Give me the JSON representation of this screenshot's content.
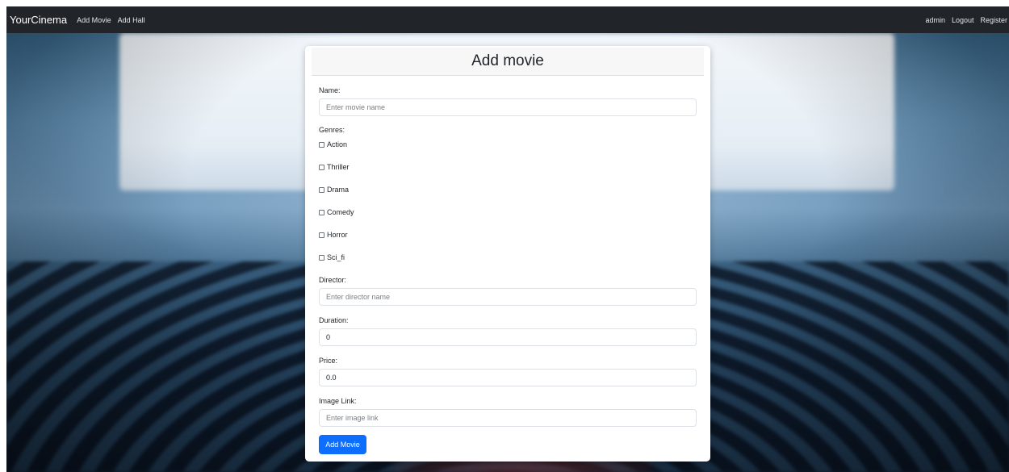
{
  "navbar": {
    "brand": "YourCinema",
    "links": [
      "Add Movie",
      "Add Hall"
    ],
    "right_links": [
      "admin",
      "Logout",
      "Register"
    ],
    "background_color": "#212529"
  },
  "form": {
    "title": "Add movie",
    "name_label": "Name:",
    "name_placeholder": "Enter movie name",
    "genres_label": "Genres:",
    "genres": [
      "Action",
      "Thriller",
      "Drama",
      "Comedy",
      "Horror",
      "Sci_fi"
    ],
    "director_label": "Director:",
    "director_placeholder": "Enter director name",
    "duration_label": "Duration:",
    "duration_value": "0",
    "price_label": "Price:",
    "price_value": "0.0",
    "image_label": "Image Link:",
    "image_placeholder": "Enter image link",
    "submit_label": "Add Movie",
    "accent_color": "#0d6efd"
  }
}
